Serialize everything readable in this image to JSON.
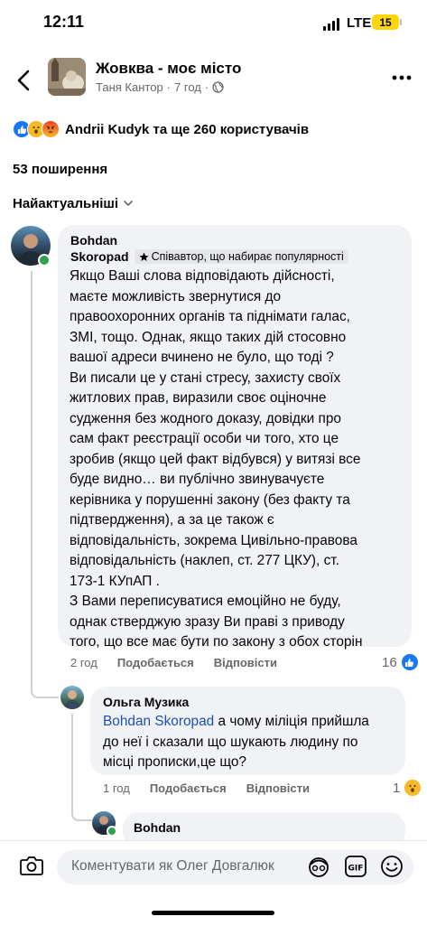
{
  "status": {
    "time": "12:11",
    "network": "LTE",
    "battery": "15"
  },
  "header": {
    "group_name": "Жовква - моє місто",
    "author": "Таня Кантор",
    "time": "7 год"
  },
  "reactions": {
    "text": "Andrii Kudyk та ще 260 користувачів",
    "icons": [
      "like-icon",
      "wow-icon",
      "angry-icon"
    ]
  },
  "shares": "53 поширення",
  "sort": {
    "label": "Найактуальніші"
  },
  "comments": [
    {
      "author_line1": "Bohdan",
      "author_line2": "Skoropad",
      "badge": "Співавтор, що набирає популярності",
      "text": "Якщо Ваші слова відповідають дійсності,\nмаєте можливість звернутися до\nправоохоронних органів та піднімати галас,\nЗМІ, тощо. Однак, якщо таких дій стосовно\nвашої адреси вчинено не було, що тоді ?\nВи писали це у стані стресу, захисту своїх\nжитлових прав, виразили своє оціночне\nсудження без жодного доказу, довідки про\nсам факт реєстрації особи чи того, хто це\nзробив (якщо цей факт відбувся) у витязі все\nбуде видно… ви публічно звинувачуєте\nкерівника у порушенні закону (без факту та\nпідтвердження), а за це також є\nвідповідальність, зокрема Цивільно-правова\nвідповідальність (наклеп, ст. 277 ЦКУ), ст.\n173-1 КУпАП .\nЗ Вами переписуватися емоційно не буду,\nоднак стверджую зразу Ви праві з приводу\nтого, що все має бути по закону з обох сторін",
      "time": "2 год",
      "like_label": "Подобається",
      "reply_label": "Відповісти",
      "reaction_count": "16"
    },
    {
      "author": "Ольга Музика",
      "mention": "Bohdan Skoropad",
      "text_first": " а чому міліція прийшла",
      "text_rest": "до неї і сказали що шукають людину по\nмісці прописки,це що?",
      "time": "1 год",
      "like_label": "Подобається",
      "reply_label": "Відповісти",
      "reaction_count": "1"
    },
    {
      "author": "Bohdan"
    }
  ],
  "composer": {
    "placeholder": "Коментувати як Олег Довгалюк"
  }
}
